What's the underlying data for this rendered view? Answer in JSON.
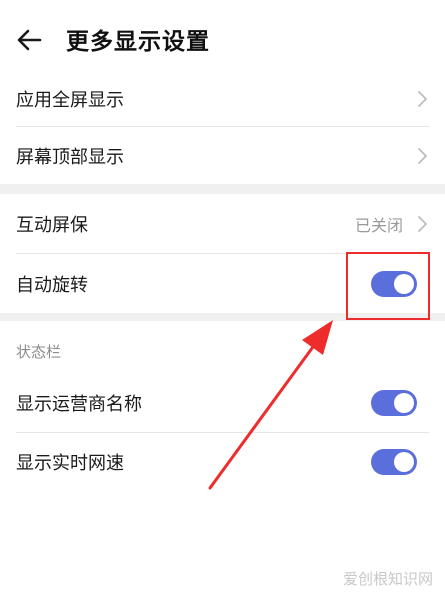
{
  "header": {
    "title": "更多显示设置"
  },
  "group1": {
    "items": [
      {
        "label": "应用全屏显示"
      },
      {
        "label": "屏幕顶部显示"
      }
    ]
  },
  "group2": {
    "items": [
      {
        "label": "互动屏保",
        "value": "已关闭"
      },
      {
        "label": "自动旋转",
        "toggle_on": true
      }
    ]
  },
  "statusbar": {
    "section_title": "状态栏",
    "items": [
      {
        "label": "显示运营商名称",
        "toggle_on": true
      },
      {
        "label": "显示实时网速",
        "toggle_on": true
      }
    ]
  },
  "colors": {
    "accent": "#5b6fdc",
    "annotation": "#ee2c2c"
  },
  "watermark": "爱创根知识网"
}
